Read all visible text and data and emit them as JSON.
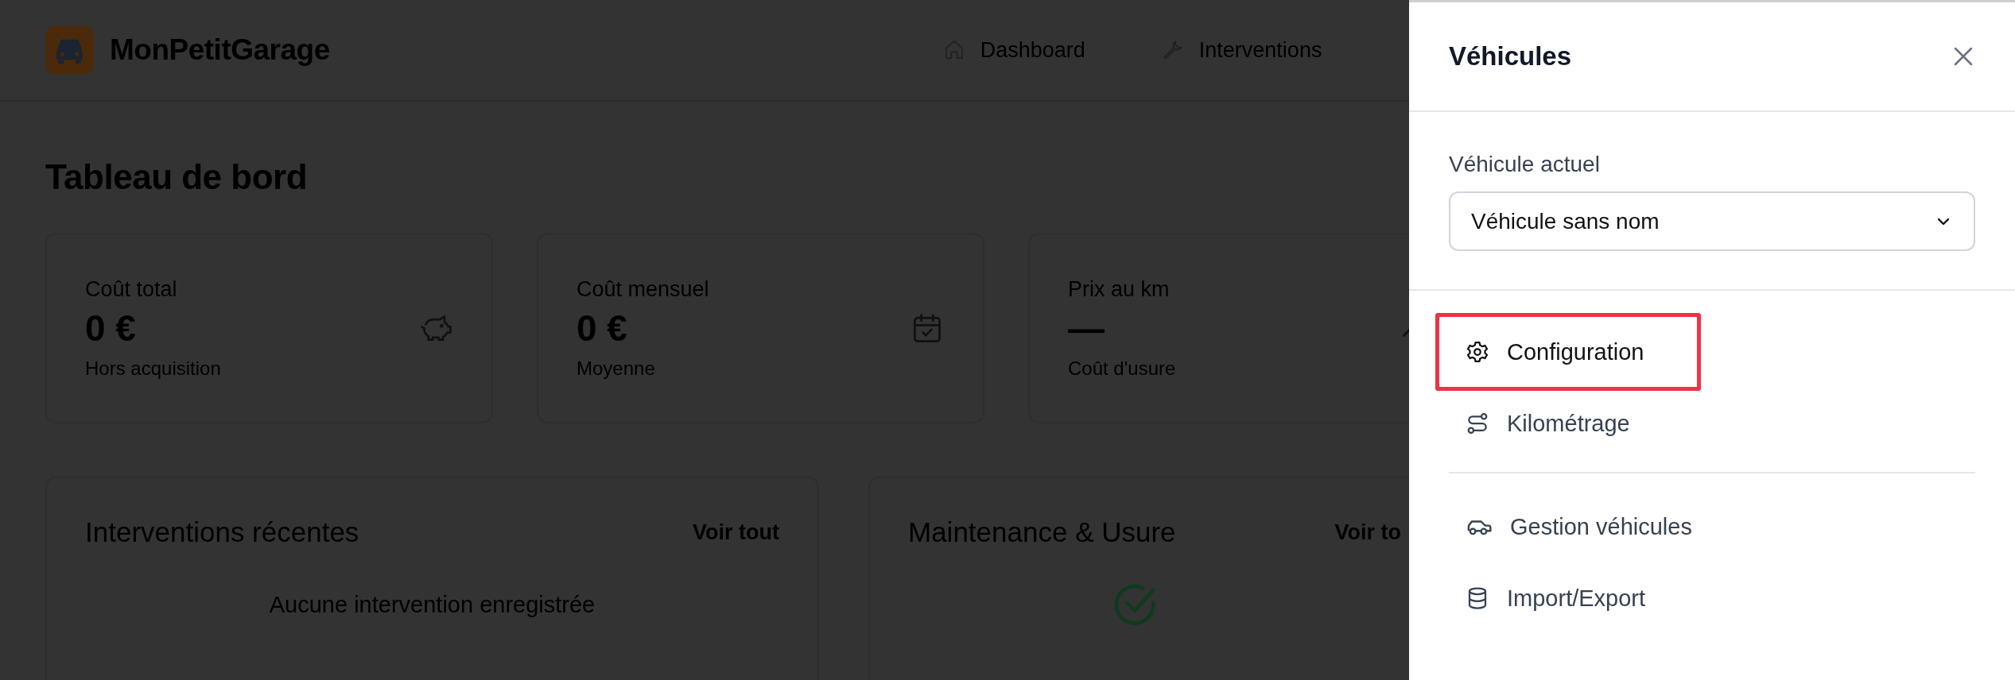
{
  "header": {
    "app_name": "MonPetitGarage",
    "nav": [
      {
        "label": "Dashboard"
      },
      {
        "label": "Interventions"
      }
    ]
  },
  "page_title": "Tableau de bord",
  "stat_cards": [
    {
      "label": "Coût total",
      "value": "0 €",
      "sub": "Hors acquisition"
    },
    {
      "label": "Coût mensuel",
      "value": "0 €",
      "sub": "Moyenne"
    },
    {
      "label": "Prix au km",
      "value": "—",
      "sub": "Coût d'usure"
    }
  ],
  "panels": [
    {
      "title": "Interventions récentes",
      "link": "Voir tout",
      "empty_text": "Aucune intervention enregistrée"
    },
    {
      "title": "Maintenance & Usure",
      "link": "Voir to"
    }
  ],
  "drawer": {
    "title": "Véhicules",
    "field_label": "Véhicule actuel",
    "select_value": "Véhicule sans nom",
    "menu_groups": [
      [
        {
          "label": "Configuration",
          "selected": true
        },
        {
          "label": "Kilométrage",
          "selected": false
        }
      ],
      [
        {
          "label": "Gestion véhicules",
          "selected": false
        },
        {
          "label": "Import/Export",
          "selected": false
        }
      ]
    ]
  }
}
